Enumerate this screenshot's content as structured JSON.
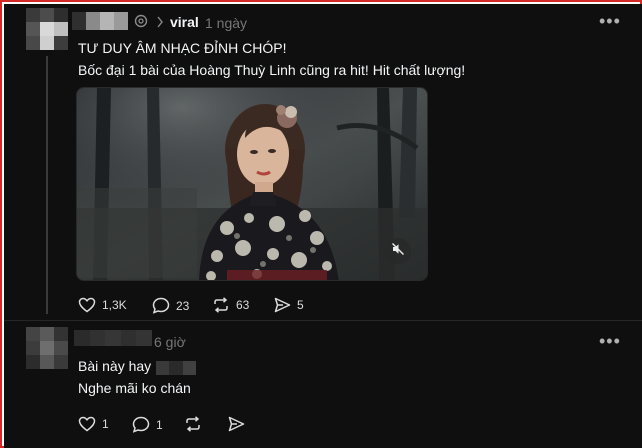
{
  "post": {
    "avatar_blurred": true,
    "username_blurred": true,
    "topic": "viral",
    "time": "1 ngày",
    "headline": "TƯ DUY ÂM NHẠC ĐỈNH CHÓP!",
    "text": "Bốc đại 1 bài của Hoàng Thuỳ Linh cũng ra hit! Hit chất lượng!",
    "media": {
      "type": "video",
      "muted": true
    },
    "actions": {
      "likes": "1,3K",
      "comments": "23",
      "reposts": "63",
      "shares": "5"
    }
  },
  "reply": {
    "avatar_blurred": true,
    "username_blurred": true,
    "time": "6 giờ",
    "line1": "Bài này hay",
    "line2": "Nghe mãi ko chán",
    "actions": {
      "likes": "1",
      "comments": "1"
    }
  },
  "icons": {
    "topic": "threads-topic-icon",
    "chevron": "chevron-right-icon",
    "more": "more-options-icon",
    "like": "heart-icon",
    "comment": "comment-icon",
    "repost": "repost-icon",
    "share": "send-icon",
    "mute": "speaker-muted-icon"
  },
  "colors": {
    "background": "#0f0f0f",
    "text": "#f3f5f7",
    "muted": "#777777",
    "frame": "#d42a2a"
  }
}
